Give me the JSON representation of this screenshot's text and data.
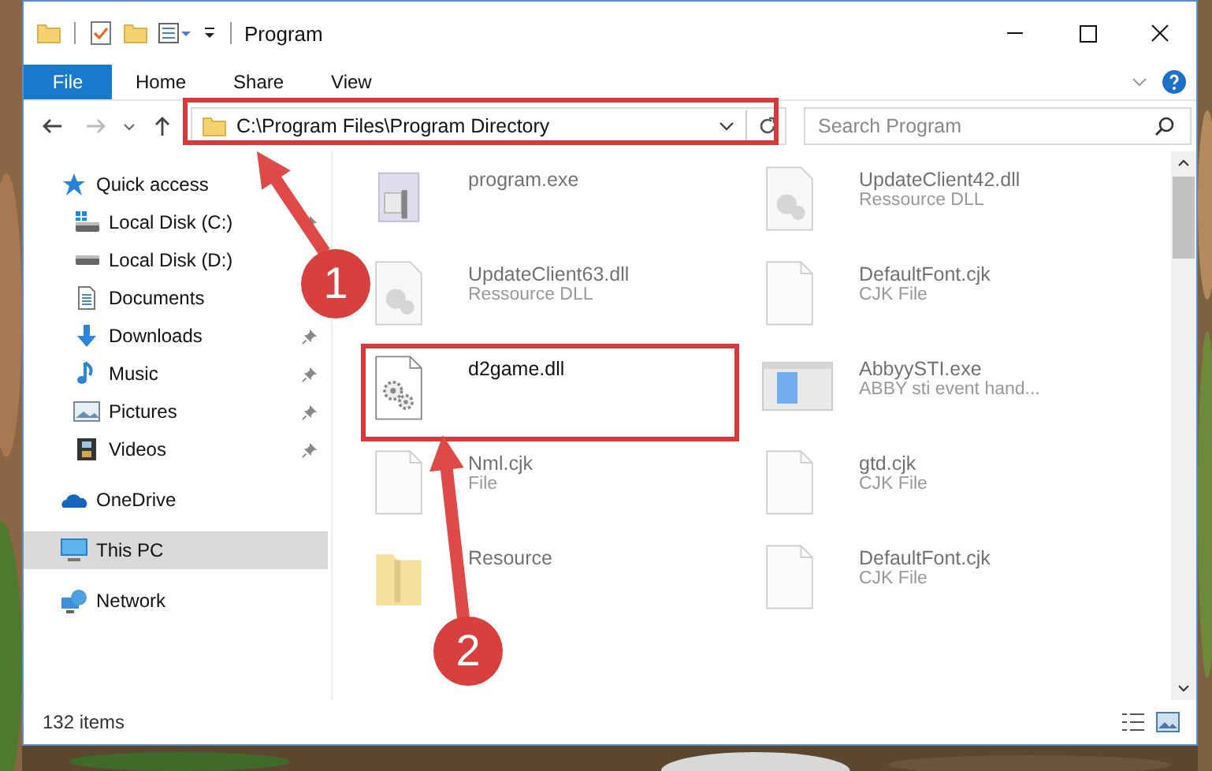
{
  "window": {
    "title": "Program"
  },
  "ribbon_tabs": [
    {
      "label": "File",
      "kind": "menu",
      "selected": false
    },
    {
      "label": "Home",
      "kind": "tab",
      "selected": false
    },
    {
      "label": "Share",
      "kind": "tab",
      "selected": false
    },
    {
      "label": "View",
      "kind": "tab",
      "selected": false
    }
  ],
  "address": {
    "path": "C:\\Program Files\\Program Directory"
  },
  "search": {
    "placeholder": "Search Program"
  },
  "sidebar": {
    "items": [
      {
        "label": "Quick access",
        "kind": "quick",
        "selected": false,
        "children": [
          {
            "label": "Local Disk (C:)",
            "kind": "sysdrive",
            "pinned": true,
            "selected": false
          },
          {
            "label": "Local Disk (D:)",
            "kind": "drive",
            "pinned": false,
            "selected": false
          },
          {
            "label": "Documents",
            "kind": "documents",
            "pinned": false,
            "selected": false
          },
          {
            "label": "Downloads",
            "kind": "downloads",
            "pinned": true,
            "selected": false
          },
          {
            "label": "Music",
            "kind": "music",
            "pinned": true,
            "selected": false
          },
          {
            "label": "Pictures",
            "kind": "pictures",
            "pinned": true,
            "selected": false
          },
          {
            "label": "Videos",
            "kind": "videos",
            "pinned": true,
            "selected": false
          }
        ]
      },
      {
        "label": "OneDrive",
        "kind": "cloud",
        "selected": false
      },
      {
        "label": "This PC",
        "kind": "computer",
        "selected": true
      },
      {
        "label": "Network",
        "kind": "network",
        "selected": false
      }
    ]
  },
  "files": [
    {
      "name": "program.exe",
      "kind": "app",
      "dimmed": true
    },
    {
      "name": "UpdateClient42.dll",
      "type": "Ressource DLL",
      "kind": "dll",
      "dimmed": true
    },
    {
      "name": "UpdateClient63.dll",
      "type": "Ressource DLL",
      "kind": "dll",
      "dimmed": true
    },
    {
      "name": "DefaultFont.cjk",
      "type": "CJK File",
      "kind": "blank",
      "dimmed": true
    },
    {
      "name": "d2game.dll",
      "kind": "settings",
      "dimmed": false
    },
    {
      "name": "AbbyySTI.exe",
      "type": "ABBY sti event hand...",
      "kind": "window",
      "dimmed": true
    },
    {
      "name": "Nml.cjk",
      "type": "File",
      "kind": "blank",
      "dimmed": true
    },
    {
      "name": "gtd.cjk",
      "type": "CJK File",
      "kind": "blank",
      "dimmed": true
    },
    {
      "name": "Resource",
      "kind": "folder",
      "dimmed": true
    },
    {
      "name": "DefaultFont.cjk",
      "type": "CJK File",
      "kind": "blank",
      "dimmed": true
    }
  ],
  "status_bar": {
    "text": "132 items"
  },
  "annotations": [
    {
      "kind": "box"
    },
    {
      "kind": "arrow",
      "number": "1"
    },
    {
      "kind": "box"
    },
    {
      "kind": "arrow",
      "number": "2"
    }
  ]
}
